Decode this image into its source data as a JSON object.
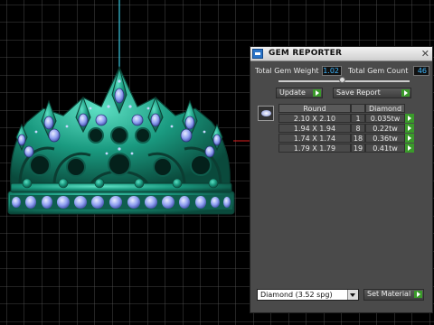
{
  "panel": {
    "title": "GEM REPORTER",
    "total_gem_weight_label": "Total Gem Weight",
    "total_gem_weight_value": "1.02",
    "total_gem_count_label": "Total Gem Count",
    "total_gem_count_value": "46",
    "update_label": "Update",
    "save_report_label": "Save Report",
    "columns": [
      "Round",
      "Diamond"
    ],
    "rows": [
      {
        "size": "2.10 X 2.10",
        "count": "1",
        "weight": "0.035tw"
      },
      {
        "size": "1.94 X 1.94",
        "count": "8",
        "weight": "0.22tw"
      },
      {
        "size": "1.74 X 1.74",
        "count": "18",
        "weight": "0.36tw"
      },
      {
        "size": "1.79 X 1.79",
        "count": "19",
        "weight": "0.41tw"
      }
    ],
    "material_value": "Diamond   (3.52 spg)",
    "set_material_label": "Set Material"
  },
  "colors": {
    "crown_metal": "#1fa088",
    "gem": "#8fa0f0",
    "accent_blue": "#3fb8ff",
    "go_green": "#3a9a2a"
  }
}
